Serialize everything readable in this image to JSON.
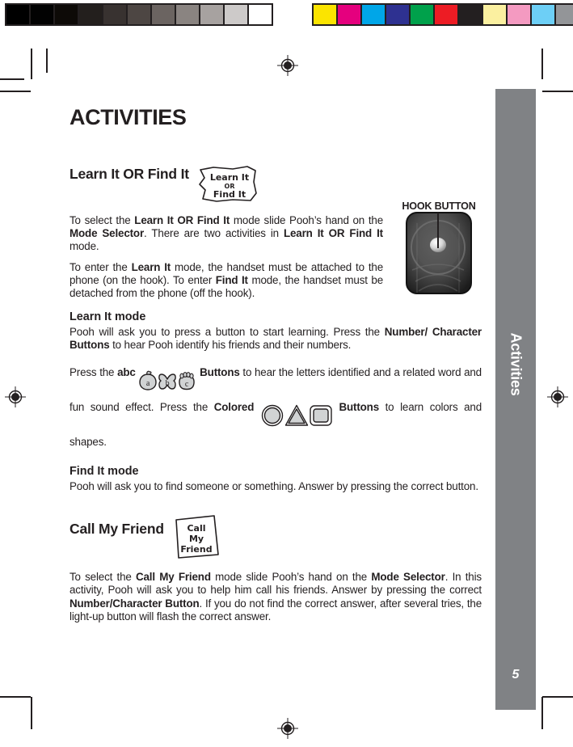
{
  "document": {
    "page_title": "ACTIVITIES",
    "page_number": "5",
    "side_tab_label": "Activities"
  },
  "calibration": {
    "grayscale_swatches": [
      "#000000",
      "#020202",
      "#0d0a07",
      "#231f1d",
      "#383230",
      "#4d4643",
      "#6b6461",
      "#8a8481",
      "#a7a2a0",
      "#cdcac9",
      "#ffffff"
    ],
    "color_swatches": [
      "#fbe400",
      "#e5007e",
      "#00a6e8",
      "#2e3191",
      "#00a14b",
      "#ed1c24",
      "#231f20",
      "#fbf0a0",
      "#f49ac1",
      "#6dcff6",
      "#939598"
    ]
  },
  "sections": [
    {
      "heading": "Learn It OR Find It",
      "sticker": {
        "name": "learn-it-or-find-it-sticker",
        "lines": [
          "Learn It",
          "OR",
          "Find It"
        ]
      },
      "paragraphs": [
        [
          {
            "t": "To select the ",
            "b": false
          },
          {
            "t": "Learn It OR Find It",
            "b": true
          },
          {
            "t": " mode slide Pooh’s hand on the ",
            "b": false
          },
          {
            "t": "Mode Selector",
            "b": true
          },
          {
            "t": ".  There are two activities in ",
            "b": false
          },
          {
            "t": "Learn It OR Find It",
            "b": true
          },
          {
            "t": " mode.",
            "b": false
          }
        ],
        [
          {
            "t": "To enter the ",
            "b": false
          },
          {
            "t": "Learn It",
            "b": true
          },
          {
            "t": " mode, the handset must be attached to the phone (on the hook).  To enter ",
            "b": false
          },
          {
            "t": "Find It",
            "b": true
          },
          {
            "t": " mode, the handset must be detached from the phone  (off the hook).",
            "b": false
          }
        ]
      ]
    }
  ],
  "learn_it_mode": {
    "heading": "Learn It mode",
    "paragraph": [
      {
        "t": "Pooh will ask you to press a button to start learning. Press the ",
        "b": false
      },
      {
        "t": "Number/ Character Buttons",
        "b": true
      },
      {
        "t": " to hear Pooh identify his friends and their numbers.",
        "b": false
      }
    ],
    "icon_paragraph": {
      "lead_plain": "Press the ",
      "lead_bold": "abc",
      "abc_icons": [
        {
          "name": "apple-button-icon",
          "letter": "a"
        },
        {
          "name": "butterfly-button-icon",
          "letter": "b"
        },
        {
          "name": "paw-button-icon",
          "letter": "c"
        }
      ],
      "after_abc_bold": "Buttons",
      "mid_plain": " to hear the letters identified and a related word and fun sound effect. Press the ",
      "colored_bold": "Colored",
      "shape_icons": [
        {
          "name": "circle-shape-button-icon",
          "shape": "circle"
        },
        {
          "name": "triangle-shape-button-icon",
          "shape": "triangle"
        },
        {
          "name": "square-shape-button-icon",
          "shape": "square"
        }
      ],
      "after_shapes_bold": "Buttons",
      "tail_plain": " to learn colors and shapes."
    }
  },
  "find_it_mode": {
    "heading": "Find It mode",
    "paragraph": [
      {
        "t": "Pooh will ask you to find someone or something.  Answer by pressing the correct button.",
        "b": false
      }
    ]
  },
  "call_my_friend": {
    "heading": "Call My Friend",
    "sticker": {
      "name": "call-my-friend-sticker",
      "lines": [
        "Call",
        "My",
        "Friend"
      ]
    },
    "paragraph": [
      {
        "t": "To select the ",
        "b": false
      },
      {
        "t": "Call My Friend",
        "b": true
      },
      {
        "t": " mode slide Pooh’s hand on the ",
        "b": false
      },
      {
        "t": "Mode Selector",
        "b": true
      },
      {
        "t": ". In this activity, Pooh will ask you to help him call his friends.  Answer by pressing the correct ",
        "b": false
      },
      {
        "t": "Number/Character Button",
        "b": true
      },
      {
        "t": ". If you do not find the correct answer, after several tries, the light-up button will flash the correct answer.",
        "b": false
      }
    ]
  },
  "hook_callout": {
    "label": "HOOK BUTTON"
  },
  "colors": {
    "tab_gray": "#808285",
    "ink": "#231f20",
    "icon_fill": "#d1d3d4"
  }
}
